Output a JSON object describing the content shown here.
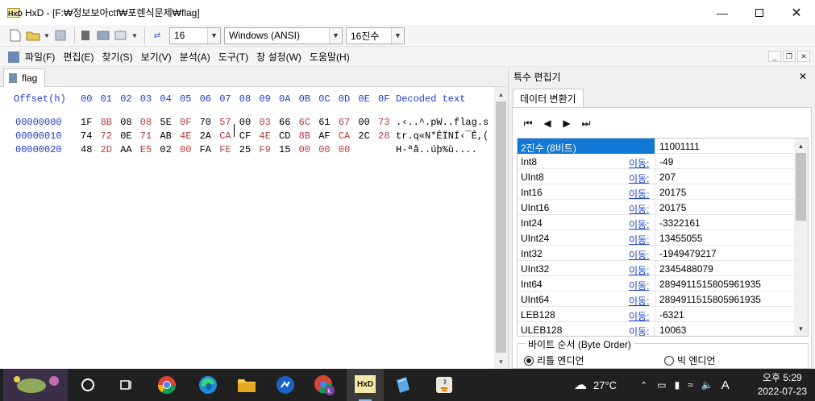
{
  "window": {
    "title": "HxD - [F:₩정보보아ctf₩포렌식문제₩flag]",
    "app_icon": "HxD",
    "controls": [
      "minimize-icon",
      "maximize-icon",
      "close-icon"
    ]
  },
  "toolbar": {
    "bytes_per_row": "16",
    "charset": "Windows (ANSI)",
    "offset_base": "16진수"
  },
  "menu": {
    "items": [
      "파일(F)",
      "편집(E)",
      "찾기(S)",
      "보기(V)",
      "분석(A)",
      "도구(T)",
      "창 설정(W)",
      "도움말(H)"
    ]
  },
  "editor": {
    "tab_label": "flag",
    "header": {
      "offset_label": "Offset(h)",
      "columns": [
        "00",
        "01",
        "02",
        "03",
        "04",
        "05",
        "06",
        "07",
        "08",
        "09",
        "0A",
        "0B",
        "0C",
        "0D",
        "0E",
        "0F"
      ],
      "decoded_label": "Decoded text"
    },
    "rows": [
      {
        "offset": "00000000",
        "bytes": [
          "1F",
          "8B",
          "08",
          "08",
          "5E",
          "0F",
          "70",
          "57",
          "00",
          "03",
          "66",
          "6C",
          "61",
          "67",
          "00",
          "73"
        ],
        "decoded": ".‹..^.pW..flag.s"
      },
      {
        "offset": "00000010",
        "bytes": [
          "74",
          "72",
          "0E",
          "71",
          "AB",
          "4E",
          "2A",
          "CA",
          "CF",
          "4E",
          "CD",
          "8B",
          "AF",
          "CA",
          "2C",
          "28"
        ],
        "decoded": "tr.q«N*ÊÏNÍ‹¯Ê,("
      },
      {
        "offset": "00000020",
        "bytes": [
          "48",
          "2D",
          "AA",
          "E5",
          "02",
          "00",
          "FA",
          "FE",
          "25",
          "F9",
          "15",
          "00",
          "00",
          "00"
        ],
        "decoded": "H-ªå..úþ%ù...."
      }
    ]
  },
  "side_panel": {
    "title": "특수 편집기",
    "tab": "데이터 변환기",
    "nav_buttons": [
      "first-icon",
      "prev-icon",
      "next-icon",
      "last-icon"
    ],
    "link_label": "이동:",
    "conversions": [
      {
        "type": "2진수 (8비트)",
        "value": "11001111",
        "link": false
      },
      {
        "type": "Int8",
        "value": "-49",
        "link": true
      },
      {
        "type": "UInt8",
        "value": "207",
        "link": true
      },
      {
        "type": "Int16",
        "value": "20175",
        "link": true
      },
      {
        "type": "UInt16",
        "value": "20175",
        "link": true
      },
      {
        "type": "Int24",
        "value": "-3322161",
        "link": true
      },
      {
        "type": "UInt24",
        "value": "13455055",
        "link": true
      },
      {
        "type": "Int32",
        "value": "-1949479217",
        "link": true
      },
      {
        "type": "UInt32",
        "value": "2345488079",
        "link": true
      },
      {
        "type": "Int64",
        "value": "2894911515805961935",
        "link": true
      },
      {
        "type": "UInt64",
        "value": "2894911515805961935",
        "link": true
      },
      {
        "type": "LEB128",
        "value": "-6321",
        "link": true
      },
      {
        "type": "ULEB128",
        "value": "10063",
        "link": true
      }
    ],
    "byte_order_label": "바이트 순서 (Byte Order)",
    "little_endian": "리틀 엔디언",
    "big_endian": "빅 엔디언"
  },
  "taskbar": {
    "temperature": "27°C",
    "ime": "A",
    "time": "오후 5:29",
    "date": "2022-07-23"
  }
}
